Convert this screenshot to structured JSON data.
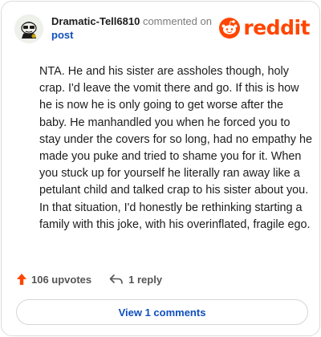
{
  "header": {
    "username": "Dramatic-Tell6810",
    "action": "commented on",
    "post_link": "post",
    "avatar_icon": "snoo-avatar-icon",
    "brand": {
      "wordmark": "reddit",
      "color": "#ff4500"
    }
  },
  "comment": {
    "body": "NTA. He and his sister are assholes though, holy crap. I'd leave the vomit there and go. If this is how he is now he is only going to get worse after the baby. He manhandled you when he forced you to stay under the covers for so long, had no empathy he made you puke and tried to shame you for it. When you stuck up for yourself he literally ran away like a petulant child and talked crap to his sister about you. In that situation, I'd honestly be rethinking starting a family with this joke, with his overinflated, fragile ego."
  },
  "footer": {
    "upvotes_label": "106 upvotes",
    "upvote_icon": "upvote-arrow-icon",
    "upvote_color": "#ff4500",
    "replies_label": "1 reply",
    "reply_icon": "reply-arrow-icon"
  },
  "view_comments_label": "View 1 comments",
  "colors": {
    "link": "#0f4fbf",
    "muted": "#7c7c7c",
    "border": "#dcdcdc"
  }
}
